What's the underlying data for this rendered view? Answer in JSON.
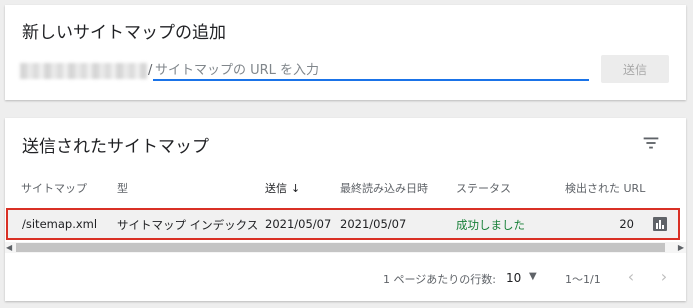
{
  "add_card": {
    "title": "新しいサイトマップの追加",
    "slash": "/",
    "input_placeholder": "サイトマップの URL を入力",
    "submit_label": "送信"
  },
  "list_card": {
    "title": "送信されたサイトマップ",
    "columns": {
      "sitemap": "サイトマップ",
      "type": "型",
      "submitted": "送信",
      "last_read": "最終読み込み日時",
      "status": "ステータス",
      "discovered_urls": "検出された URL"
    },
    "sort_arrow": "↓",
    "rows": [
      {
        "sitemap": "/sitemap.xml",
        "type": "サイトマップ インデックス",
        "submitted": "2021/05/07",
        "last_read": "2021/05/07",
        "status": "成功しました",
        "discovered_urls": "20"
      }
    ],
    "pagination": {
      "rows_per_page_label": "1 ページあたりの行数:",
      "rows_per_page": "10",
      "range": "1〜1/1"
    }
  },
  "colors": {
    "accent": "#1a73e8",
    "success": "#188038",
    "highlight_border": "#d93025"
  }
}
